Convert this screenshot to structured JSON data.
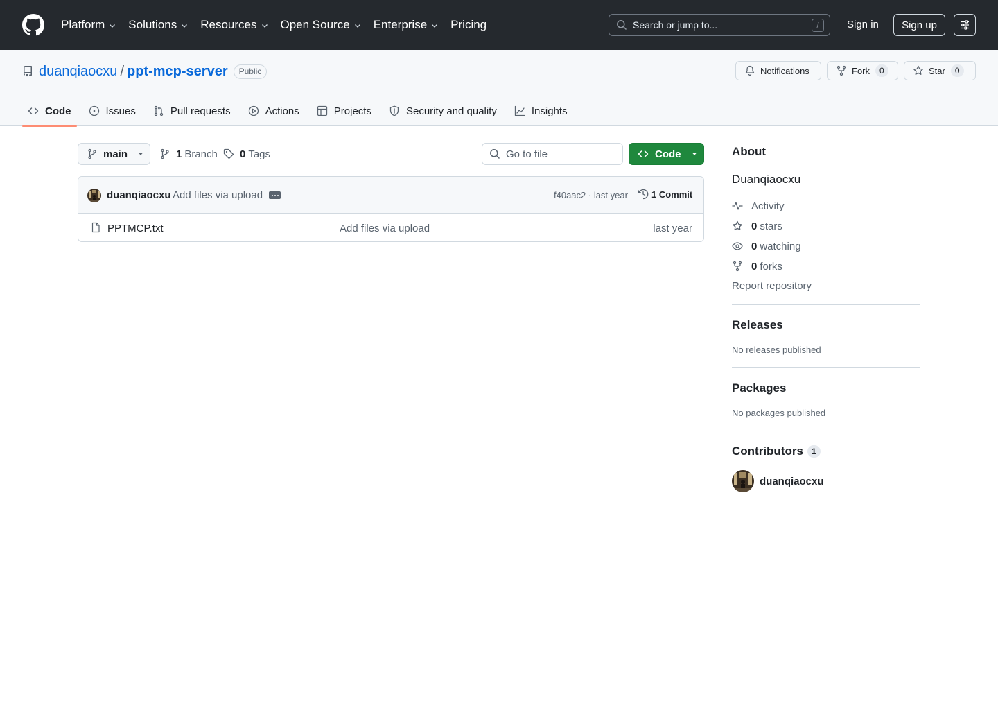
{
  "topnav": {
    "items": [
      {
        "label": "Platform",
        "dropdown": true
      },
      {
        "label": "Solutions",
        "dropdown": true
      },
      {
        "label": "Resources",
        "dropdown": true
      },
      {
        "label": "Open Source",
        "dropdown": true
      },
      {
        "label": "Enterprise",
        "dropdown": true
      },
      {
        "label": "Pricing",
        "dropdown": false
      }
    ],
    "search_placeholder": "Search or jump to...",
    "search_shortcut": "/",
    "signin_label": "Sign in",
    "signup_label": "Sign up"
  },
  "repo": {
    "owner": "duanqiaocxu",
    "separator": "/",
    "name": "ppt-mcp-server",
    "visibility": "Public",
    "notifications_label": "Notifications",
    "fork_label": "Fork",
    "fork_count": "0",
    "star_label": "Star",
    "star_count": "0"
  },
  "reponav": {
    "tabs": [
      {
        "label": "Code",
        "icon": "code-icon",
        "active": true
      },
      {
        "label": "Issues",
        "icon": "issue-icon",
        "active": false
      },
      {
        "label": "Pull requests",
        "icon": "pull-request-icon",
        "active": false
      },
      {
        "label": "Actions",
        "icon": "play-icon",
        "active": false
      },
      {
        "label": "Projects",
        "icon": "table-icon",
        "active": false
      },
      {
        "label": "Security and quality",
        "icon": "shield-icon",
        "active": false
      },
      {
        "label": "Insights",
        "icon": "graph-icon",
        "active": false
      }
    ]
  },
  "toolbar": {
    "branch": "main",
    "branch_count": "1",
    "branch_label": "Branch",
    "tag_count": "0",
    "tag_label": "Tags",
    "goto_placeholder": "Go to file",
    "code_label": "Code"
  },
  "commit": {
    "author": "duanqiaocxu",
    "message": "Add files via upload",
    "sha_time": "f40aac2 · last year",
    "commits_label": "1 Commit"
  },
  "files": [
    {
      "name": "PPTMCP.txt",
      "message": "Add files via upload",
      "time": "last year"
    }
  ],
  "sidebar": {
    "about_heading": "About",
    "description": "Duanqiaocxu",
    "activity_label": "Activity",
    "stars_count": "0",
    "stars_label": "stars",
    "watching_count": "0",
    "watching_label": "watching",
    "forks_count": "0",
    "forks_label": "forks",
    "report_label": "Report repository",
    "releases_heading": "Releases",
    "releases_note": "No releases published",
    "packages_heading": "Packages",
    "packages_note": "No packages published",
    "contributors_heading": "Contributors",
    "contributors_count": "1",
    "contributors": [
      {
        "name": "duanqiaocxu"
      }
    ]
  },
  "colors": {
    "header_bg": "#25292e",
    "link": "#0969da",
    "primary_button": "#1f883d",
    "active_tab_underline": "#fd8c73"
  }
}
